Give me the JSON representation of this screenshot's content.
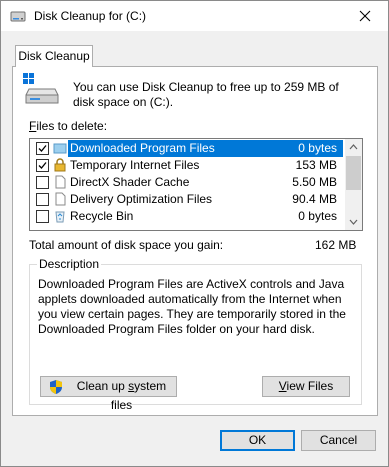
{
  "window": {
    "title": "Disk Cleanup for  (C:)"
  },
  "tabs": [
    {
      "label": "Disk Cleanup"
    }
  ],
  "intro": {
    "text": "You can use Disk Cleanup to free up to 259 MB of disk space on  (C:)."
  },
  "files": {
    "label_prefix": "F",
    "label_rest": "iles to delete:",
    "items": [
      {
        "name": "Downloaded Program Files",
        "size": "0 bytes",
        "checked": true,
        "selected": true,
        "icon": "folder-icon"
      },
      {
        "name": "Temporary Internet Files",
        "size": "153 MB",
        "checked": true,
        "selected": false,
        "icon": "lock-icon"
      },
      {
        "name": "DirectX Shader Cache",
        "size": "5.50 MB",
        "checked": false,
        "selected": false,
        "icon": "file-icon"
      },
      {
        "name": "Delivery Optimization Files",
        "size": "90.4 MB",
        "checked": false,
        "selected": false,
        "icon": "file-icon"
      },
      {
        "name": "Recycle Bin",
        "size": "0 bytes",
        "checked": false,
        "selected": false,
        "icon": "recycle-bin-icon"
      }
    ]
  },
  "total": {
    "label": "Total amount of disk space you gain:",
    "value": "162 MB"
  },
  "description": {
    "legend": "Description",
    "text": "Downloaded Program Files are ActiveX controls and Java applets downloaded automatically from the Internet when you view certain pages. They are temporarily stored in the Downloaded Program Files folder on your hard disk."
  },
  "buttons": {
    "cleanup_system_prefix": "Clean up ",
    "cleanup_system_underlined": "s",
    "cleanup_system_rest": "ystem files",
    "view_files_underlined": "V",
    "view_files_rest": "iew Files",
    "ok": "OK",
    "cancel": "Cancel"
  },
  "colors": {
    "selection": "#0078d7",
    "dialog_bg": "#f0f0f0"
  }
}
